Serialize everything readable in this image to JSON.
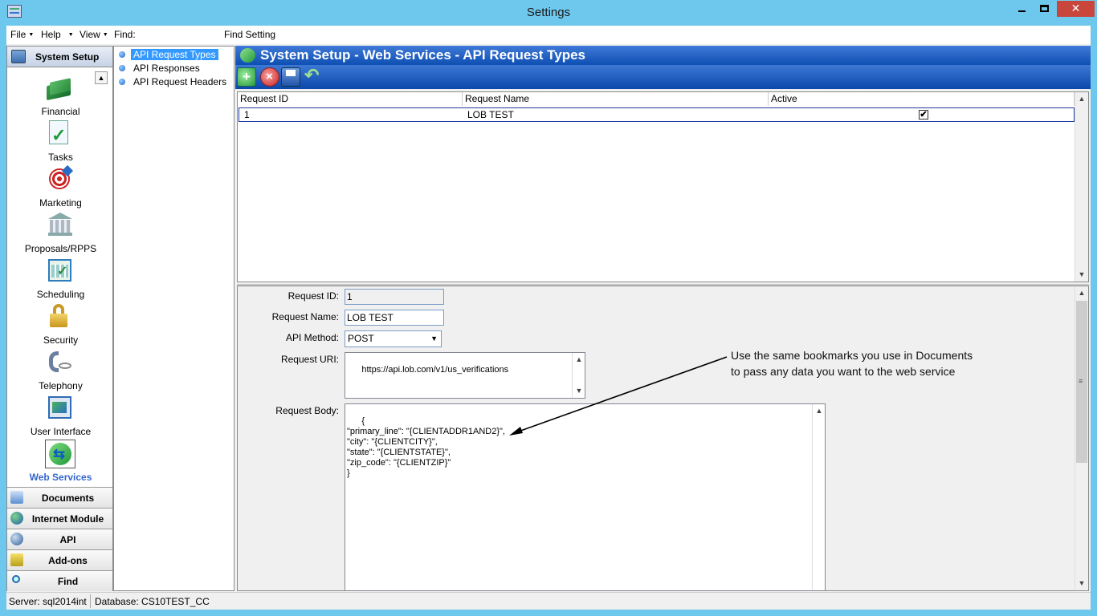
{
  "window": {
    "title": "Settings",
    "close_glyph": "✕"
  },
  "menu": {
    "file": "File",
    "help": "Help",
    "view": "View",
    "find": "Find:",
    "find_setting": "Find Setting"
  },
  "sidebar": {
    "header": "System Setup",
    "items": [
      {
        "label": "Financial",
        "icon": "money-icon"
      },
      {
        "label": "Tasks",
        "icon": "checklist-icon"
      },
      {
        "label": "Marketing",
        "icon": "target-icon"
      },
      {
        "label": "Proposals/RPPS",
        "icon": "bank-icon"
      },
      {
        "label": "Scheduling",
        "icon": "calendar-icon"
      },
      {
        "label": "Security",
        "icon": "lock-icon"
      },
      {
        "label": "Telephony",
        "icon": "phone-icon"
      },
      {
        "label": "User Interface",
        "icon": "ui-icon"
      },
      {
        "label": "Web Services",
        "icon": "web-services-icon"
      }
    ],
    "categories": [
      {
        "label": "Documents"
      },
      {
        "label": "Internet Module"
      },
      {
        "label": "API"
      },
      {
        "label": "Add-ons"
      },
      {
        "label": "Find"
      }
    ]
  },
  "tree": {
    "items": [
      {
        "label": "API Request Types",
        "selected": true
      },
      {
        "label": "API Responses"
      },
      {
        "label": "API Request Headers"
      }
    ]
  },
  "main": {
    "title": "System Setup - Web Services - API Request Types",
    "grid": {
      "columns": [
        "Request ID",
        "Request Name",
        "Active"
      ],
      "rows": [
        {
          "id": "1",
          "name": "LOB TEST",
          "active_glyph": "✔"
        }
      ]
    },
    "form": {
      "request_id_label": "Request ID:",
      "request_id": "1",
      "request_name_label": "Request Name:",
      "request_name": "LOB TEST",
      "api_method_label": "API Method:",
      "api_method": "POST",
      "request_uri_label": "Request URI:",
      "request_uri": "https://api.lob.com/v1/us_verifications",
      "request_body_label": "Request Body:",
      "request_body": "{\n\"primary_line\": \"{CLIENTADDR1AND2}\",\n\"city\": \"{CLIENTCITY}\",\n\"state\": \"{CLIENTSTATE}\",\n\"zip_code\": \"{CLIENTZIP}\"\n}"
    }
  },
  "annotation": {
    "line1": "Use the same bookmarks you use in Documents",
    "line2": "to pass any data you want to the web service"
  },
  "statusbar": {
    "server": "Server: sql2014int",
    "database": "Database: CS10TEST_CC"
  }
}
